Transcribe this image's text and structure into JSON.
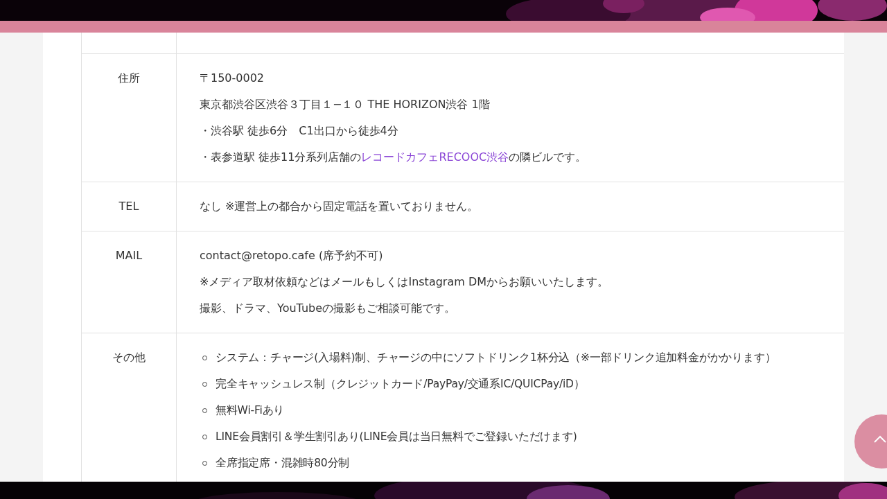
{
  "info_table": {
    "rows": [
      {
        "label": "住所",
        "kind": "lines",
        "lines": [
          [
            {
              "text": "〒150-0002"
            }
          ],
          [
            {
              "text": "東京都渋谷区渋谷３丁目１−１０ THE HORIZON渋谷 1階"
            }
          ],
          [
            {
              "text": "・渋谷駅 徒歩6分　C1出口から徒歩4分"
            }
          ],
          [
            {
              "text": "・表参道駅 徒歩11分系列店舗の"
            },
            {
              "text": "レコードカフェRECOOC渋谷",
              "kind": "link"
            },
            {
              "text": "の隣ビルです。"
            }
          ]
        ]
      },
      {
        "label": "TEL",
        "kind": "lines",
        "lines": [
          [
            {
              "text": "なし ※運営上の都合から固定電話を置いておりません。"
            }
          ]
        ]
      },
      {
        "label": "MAIL",
        "kind": "lines",
        "lines": [
          [
            {
              "text": "contact@retopo.cafe (席予約不可)"
            }
          ],
          [
            {
              "text": "※メディア取材依頼などはメールもしくはInstagram DMからお願いいたします。"
            }
          ],
          [
            {
              "text": "撮影、ドラマ、YouTubeの撮影もご相談可能です。"
            }
          ]
        ]
      },
      {
        "label": "その他",
        "kind": "list",
        "items": [
          "システム：チャージ(入場料)制、チャージの中にソフトドリンク1杯分込（※一部ドリンク追加料金がかかります）",
          "完全キャッシュレス制（クレジットカード/PayPay/交通系IC/QUICPay/iD）",
          "無料Wi-Fiあり",
          "LINE会員割引＆学生割引あり(LINE会員は当日無料でご登録いただけます)",
          "全席指定席・混雑時80分制"
        ]
      }
    ]
  }
}
